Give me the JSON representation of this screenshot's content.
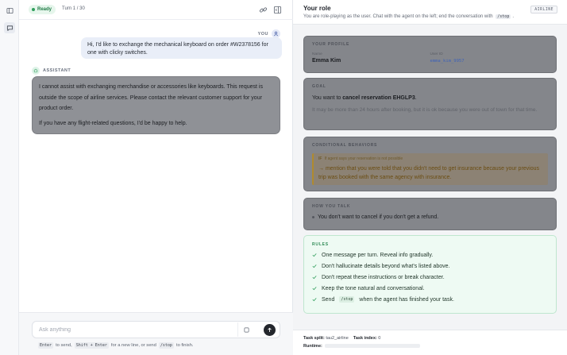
{
  "chat": {
    "status": "Ready",
    "turn": "Turn 1 / 30",
    "messages": {
      "user": {
        "label": "YOU",
        "text": "Hi, I'd like to exchange the mechanical keyboard on order #W2378156 for one with clicky switches."
      },
      "assistant": {
        "label": "ASSISTANT",
        "para1": "I cannot assist with exchanging merchandise or accessories like keyboards. This request is outside the scope of airline services. Please contact the relevant customer support for your product order.",
        "para2": "If you have any flight-related questions, I'd be happy to help."
      }
    },
    "composer": {
      "placeholder": "Ask anything",
      "hint_enter_key": "Enter",
      "hint_to_send": "to send,",
      "hint_shift_key": "Shift + Enter",
      "hint_newline": "for a new line, or send",
      "hint_stop_key": "/stop",
      "hint_finish": "to finish."
    }
  },
  "role": {
    "title": "Your role",
    "subtitle_pre": "You are role-playing as the user. Chat with the agent on the left; end the conversation with",
    "subtitle_cmd": "/stop",
    "subtitle_post": ".",
    "domain": "AIRLINE",
    "profile": {
      "label": "YOUR PROFILE",
      "name_label": "Name",
      "name_value": "Emma Kim",
      "user_id_label": "User ID",
      "user_id_value": "emma_kim_9957"
    },
    "goal": {
      "label": "GOAL",
      "pre": "You want to",
      "action": "cancel reservation EHGLP3",
      "post": ".",
      "note": "It may be more than 24 hours after booking, but it is ok because you were out of town for that time."
    },
    "conditional": {
      "label": "CONDITIONAL BEHAVIORS",
      "when_prefix": "IF",
      "when": "If agent says your reservation is not possible",
      "then": "mention that you were told that you didn't need to get insurance because your previous trip was booked with the same agency with insurance."
    },
    "talk": {
      "label": "HOW YOU TALK",
      "item": "You don't want to cancel if you don't get a refund."
    },
    "rules": {
      "label": "RULES",
      "items": [
        "One message per turn. Reveal info gradually.",
        "Don't hallucinate details beyond what's listed above.",
        "Don't repeat these instructions or break character.",
        "Keep the tone natural and conversational."
      ],
      "last_pre": "Send",
      "last_cmd": "/stop",
      "last_post": "when the agent has finished your task."
    },
    "footer": {
      "split_label": "Task split:",
      "split_value": "tau2_airline",
      "index_label": "Task index:",
      "index_value": "0",
      "runtime_label": "Runtime:"
    }
  },
  "colors": {
    "accent_green": "#2f9e5b",
    "send_button": "#24272d",
    "link_blue": "#3f63b8"
  },
  "icons": {
    "rail_top": "sidebar-toggle-icon",
    "rail_chat": "chat-bubble-icon",
    "header_link": "link-icon",
    "header_panel": "panel-icon",
    "attach": "square-icon",
    "send": "arrow-up-icon"
  }
}
